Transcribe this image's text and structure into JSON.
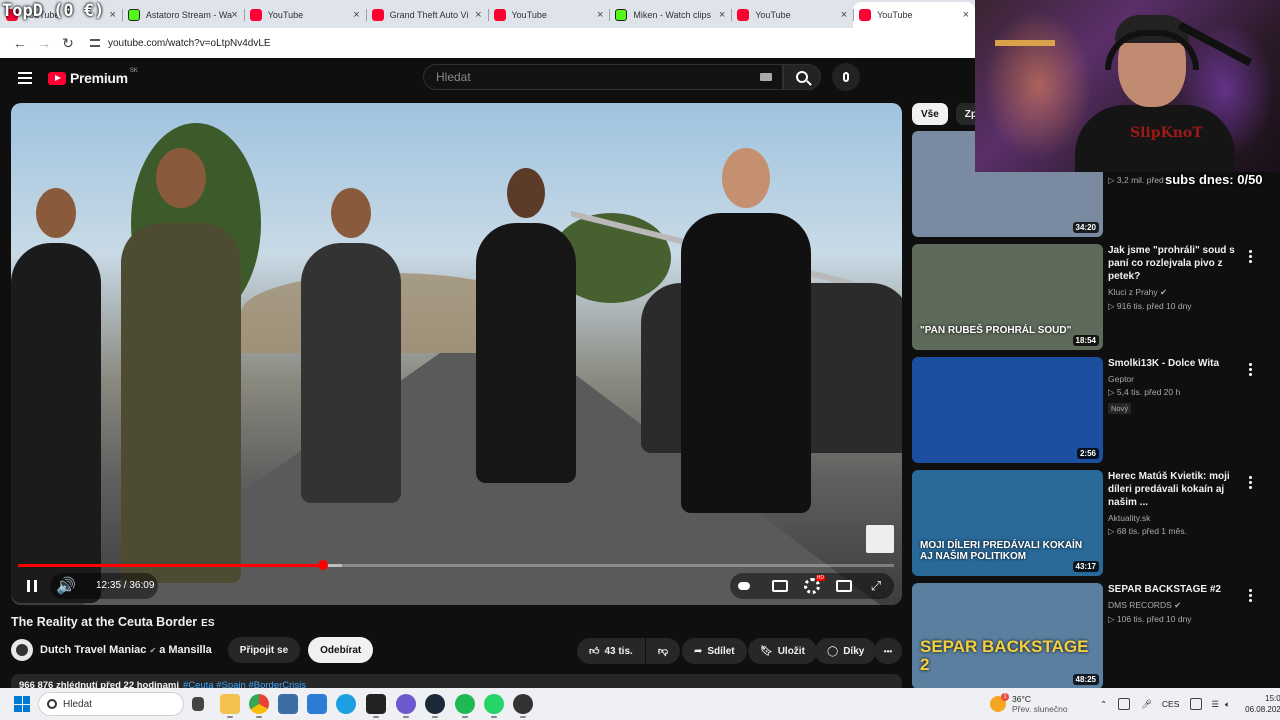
{
  "overlay": {
    "logo_text": "TopD (0 €)",
    "subs_counter": "subs dnes: 0/50"
  },
  "browser": {
    "tabs": [
      {
        "label": "YouTube",
        "icon": "youtube-icon",
        "active": false
      },
      {
        "label": "Astatoro Stream - Wa",
        "icon": "kick-icon",
        "active": false
      },
      {
        "label": "YouTube",
        "icon": "youtube-icon",
        "active": false
      },
      {
        "label": "Grand Theft Auto Vi",
        "icon": "youtube-icon",
        "active": false
      },
      {
        "label": "YouTube",
        "icon": "youtube-icon",
        "active": false
      },
      {
        "label": "Miken - Watch clips",
        "icon": "kick-icon",
        "active": false
      },
      {
        "label": "YouTube",
        "icon": "youtube-icon",
        "active": false
      },
      {
        "label": "YouTube",
        "icon": "youtube-icon",
        "active": true
      }
    ],
    "close_glyph": "×",
    "url": "youtube.com/watch?v=oLtpNv4dvLE"
  },
  "header": {
    "logo_word": "Premium",
    "logo_region": "SK",
    "search_placeholder": "Hledat"
  },
  "player": {
    "time_display": "12:35 / 36:09",
    "progress_fraction": 0.348,
    "buffered_fraction": 0.37,
    "hd_badge": "HD"
  },
  "video": {
    "title": "The Reality at the Ceuta Border",
    "title_flag": "ES",
    "channel": "Dutch Travel Maniac",
    "channel_suffix": "a Mansilla",
    "verified_glyph": "✔",
    "join_label": "Připojit se",
    "subscribe_label": "Odebírat",
    "like_count": "43 tis.",
    "share_label": "Sdílet",
    "save_label": "Uložit",
    "thanks_label": "Díky",
    "more_glyph": "•••",
    "description_stats": "966 876 zhlédnutí  před 22 hodinami",
    "description_tags": "#Ceuta #Spain #BorderCrisis"
  },
  "chips": [
    {
      "label": "Vše",
      "active": true
    },
    {
      "label": "Zpra",
      "active": false
    }
  ],
  "recommendations": [
    {
      "title": "",
      "channel": "",
      "meta": "▷ 3,2 mil.  před",
      "duration": "34:20",
      "thumb_color": "#7a8aa0",
      "thumb_text": ""
    },
    {
      "title": "Jak jsme \"prohráli\" soud s paní co rozlejvala pivo z petek?",
      "channel": "Kluci z Prahy ✔",
      "meta": "▷ 916 tis.   před 10 dny",
      "duration": "18:54",
      "thumb_color": "#5e6a5a",
      "thumb_text": "\"PAN RUBEŠ PROHRÁL SOUD\""
    },
    {
      "title": "Smolki13K - Dolce Wita",
      "channel": "Geptor",
      "meta": "▷ 5,4 tis.   před 20 h",
      "badge": "Nový",
      "duration": "2:56",
      "thumb_color": "#1c4fa0",
      "thumb_text": ""
    },
    {
      "title": "Herec Matúš Kvietik: moji díleri predávali kokaín aj našim ...",
      "channel": "Aktuality.sk",
      "meta": "▷ 68 tis.   před 1 měs.",
      "duration": "43:17",
      "thumb_color": "#2a6a9a",
      "thumb_text": "MOJI DÍLERI PREDÁVALI KOKAÍN AJ NAŠIM POLITIKOM"
    },
    {
      "title": "SEPAR BACKSTAGE #2",
      "channel": "DMS RECORDS ✔",
      "meta": "▷ 106 tis.   před 10 dny",
      "duration": "48:25",
      "thumb_color": "#5a7fa0",
      "thumb_text": "SEPAR BACKSTAGE 2"
    }
  ],
  "streamer_overlay": {
    "shirt_text": "SlipKnoT"
  },
  "taskbar": {
    "search_placeholder": "Hledat",
    "weather_temp": "36°C",
    "weather_desc": "Přev. slunečno",
    "weather_badge": "1",
    "lang": "CES",
    "time": "15:01",
    "date": "06.08.2026"
  },
  "colors": {
    "yt_red": "#ff0033",
    "kick_green": "#53fc18",
    "link_blue": "#3ea6ff",
    "bg": "#0f0f0f"
  }
}
